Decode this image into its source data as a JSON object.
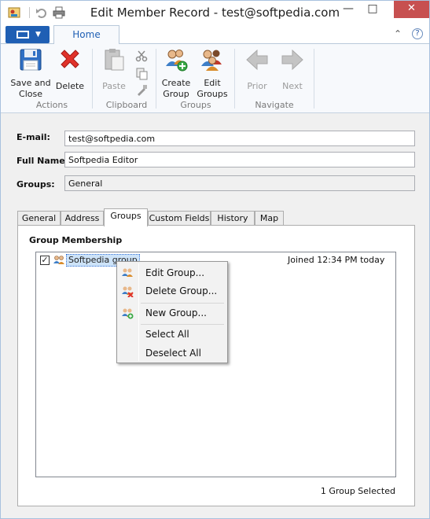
{
  "window": {
    "title": "Edit Member Record - test@softpedia.com",
    "minimize": "—",
    "maximize": "□",
    "close": "✕"
  },
  "ribbon": {
    "tab_home": "Home",
    "collapse": "⌃",
    "help": "?",
    "buttons": {
      "save_and_close": [
        "Save and",
        "Close"
      ],
      "delete": "Delete",
      "paste": "Paste",
      "create_group": [
        "Create",
        "Group"
      ],
      "edit_groups": [
        "Edit",
        "Groups"
      ],
      "prior": "Prior",
      "next": "Next"
    },
    "groups": {
      "actions": "Actions",
      "clipboard": "Clipboard",
      "groups": "Groups",
      "navigate": "Navigate"
    }
  },
  "form": {
    "email_label": "E-mail:",
    "email_value": "test@softpedia.com",
    "fullname_label": "Full Name:",
    "fullname_value": "Softpedia Editor",
    "groups_label": "Groups:",
    "groups_value": "General"
  },
  "tabs": [
    "General",
    "Address",
    "Groups",
    "Custom Fields",
    "History",
    "Map"
  ],
  "active_tab": "Groups",
  "group_membership": {
    "title": "Group Membership",
    "items": [
      {
        "name": "Softpedia group",
        "checked": true,
        "joined": "Joined 12:34 PM today"
      }
    ],
    "status": "1 Group Selected"
  },
  "context_menu": {
    "items": [
      "Edit Group...",
      "Delete Group...",
      "New Group...",
      "Select All",
      "Deselect All"
    ]
  },
  "colors": {
    "accent": "#1f5fb4",
    "close_red": "#c75050",
    "delete_red": "#e0322a",
    "nav_gray": "#b9b9b9"
  }
}
